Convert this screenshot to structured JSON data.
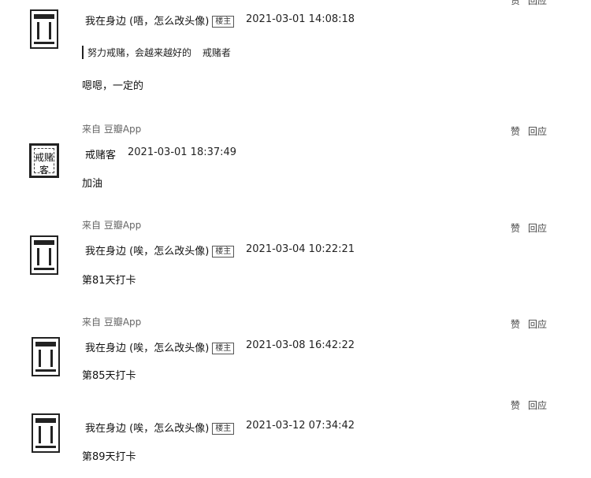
{
  "actions": {
    "like": "赞",
    "reply": "回应"
  },
  "seal_text": "戒赌客",
  "comments": [
    {
      "author": "我在身边 (唔，怎么改头像)",
      "tag": "楼主",
      "time": "2021-03-01 14:08:18",
      "quote": "努力戒赌，会越来越好的",
      "quote_author": "戒赌者",
      "content": "嗯嗯，一定的"
    },
    {
      "source": "来自 豆瓣App",
      "author": "戒赌客",
      "time": "2021-03-01 18:37:49",
      "content": "加油"
    },
    {
      "source": "来自 豆瓣App",
      "author": "我在身边 (唉，怎么改头像)",
      "tag": "楼主",
      "time": "2021-03-04 10:22:21",
      "content": "第81天打卡"
    },
    {
      "source": "来自 豆瓣App",
      "author": "我在身边 (唉，怎么改头像)",
      "tag": "楼主",
      "time": "2021-03-08 16:42:22",
      "content": "第85天打卡"
    },
    {
      "author": "我在身边 (唉，怎么改头像)",
      "tag": "楼主",
      "time": "2021-03-12 07:34:42",
      "content": "第89天打卡"
    }
  ]
}
